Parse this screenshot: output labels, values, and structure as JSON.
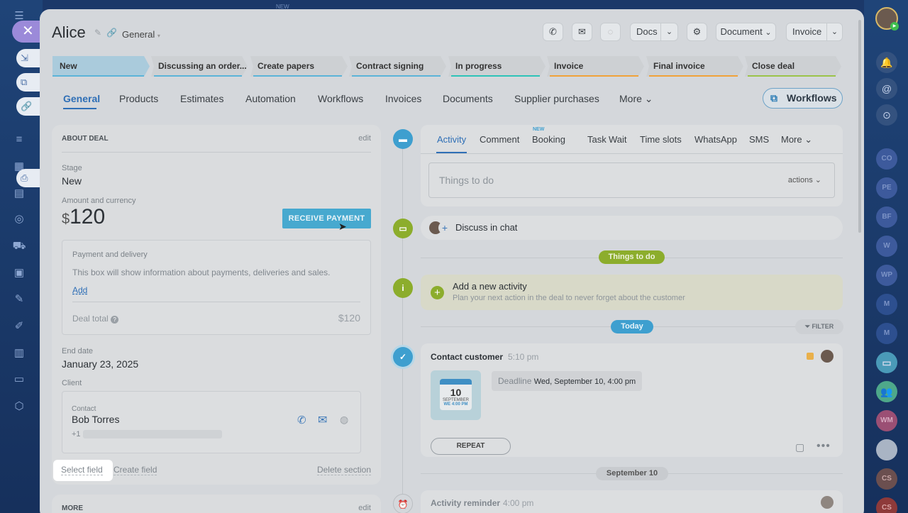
{
  "top": {
    "new_label": "NEW"
  },
  "deal": {
    "title": "Alice",
    "category": "General"
  },
  "header": {
    "docs": "Docs",
    "document": "Document",
    "invoice": "Invoice"
  },
  "stages": [
    "New",
    "Discussing an order...",
    "Create papers",
    "Contract signing",
    "In progress",
    "Invoice",
    "Final invoice",
    "Close deal"
  ],
  "stage_colors": [
    "#5cb4d8",
    "#5cb4d8",
    "#5cb4d8",
    "#5cb4d8",
    "#2ec3b8",
    "#f0a23a",
    "#f0a23a",
    "#9bc34a"
  ],
  "tabs": [
    "General",
    "Products",
    "Estimates",
    "Automation",
    "Workflows",
    "Invoices",
    "Documents",
    "Supplier purchases",
    "More"
  ],
  "workflows_button": "Workflows",
  "about": {
    "heading": "ABOUT DEAL",
    "edit": "edit",
    "stage_label": "Stage",
    "stage_value": "New",
    "amount_label": "Amount and currency",
    "currency": "$",
    "amount": "120",
    "receive": "RECEIVE PAYMENT",
    "payment_title": "Payment and delivery",
    "payment_desc": "This box will show information about payments, deliveries and sales.",
    "add": "Add",
    "deal_total_label": "Deal total",
    "deal_total": "$120",
    "end_date_label": "End date",
    "end_date": "January 23, 2025",
    "client_label": "Client",
    "contact_label": "Contact",
    "contact_name": "Bob Torres",
    "phone_prefix": "+1",
    "select_field": "Select field",
    "create_field": "Create field",
    "delete_section": "Delete section"
  },
  "more_section": {
    "heading": "MORE",
    "edit": "edit"
  },
  "activity": {
    "tabs": [
      "Activity",
      "Comment",
      "Booking",
      "Task",
      "Wait",
      "Time slots",
      "WhatsApp",
      "SMS",
      "More"
    ],
    "booking_badge": "NEW",
    "placeholder": "Things to do",
    "actions": "actions",
    "discuss": "Discuss in chat",
    "things_pill": "Things to do",
    "add_title": "Add a new activity",
    "add_desc": "Plan your next action in the deal to never forget about the customer",
    "today": "Today",
    "filter": "FILTER",
    "contact_title": "Contact customer",
    "contact_time": "5:10 pm",
    "cal_day": "10",
    "cal_month": "SEPTEMBER",
    "cal_time": "WE 4:00 PM",
    "deadline_label": "Deadline",
    "deadline_value": "Wed, September 10, 4:00 pm",
    "repeat": "REPEAT",
    "sept_pill": "September 10",
    "reminder_title": "Activity reminder",
    "reminder_time": "4:00 pm"
  },
  "right_avatars": [
    "CO",
    "PE",
    "BF",
    "W",
    "WP",
    "M",
    "M",
    "WM",
    "CS",
    "CS"
  ]
}
